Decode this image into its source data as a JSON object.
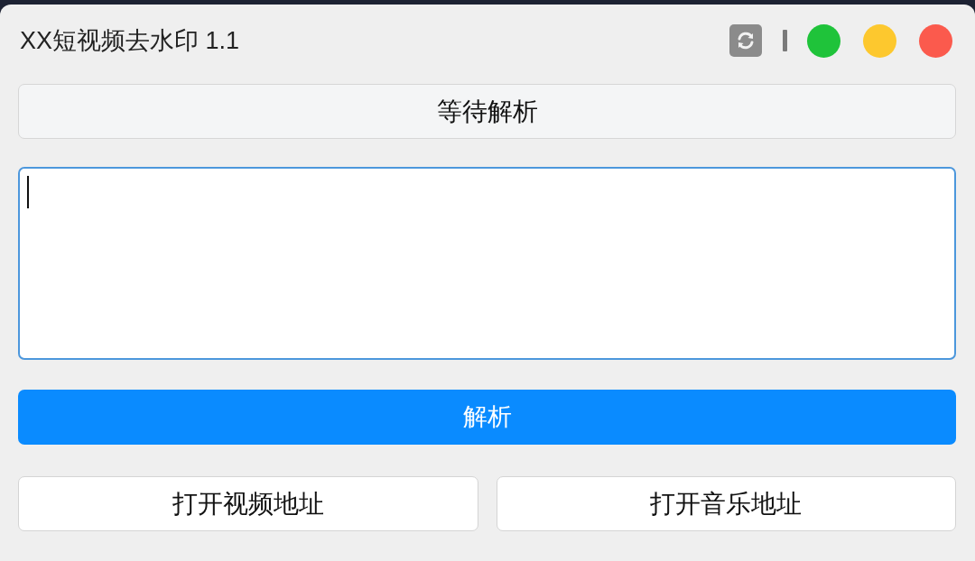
{
  "window": {
    "title": "XX短视频去水印 1.1",
    "window_buttons": [
      {
        "color": "#1fc33a"
      },
      {
        "color": "#fdc82e"
      },
      {
        "color": "#fb5a4d"
      }
    ]
  },
  "status": {
    "text": "等待解析"
  },
  "input": {
    "focused": true
  },
  "parse_button": {
    "label": "解析"
  },
  "buttons": [
    {
      "label": "打开视频地址"
    },
    {
      "label": "打开音乐地址"
    }
  ]
}
